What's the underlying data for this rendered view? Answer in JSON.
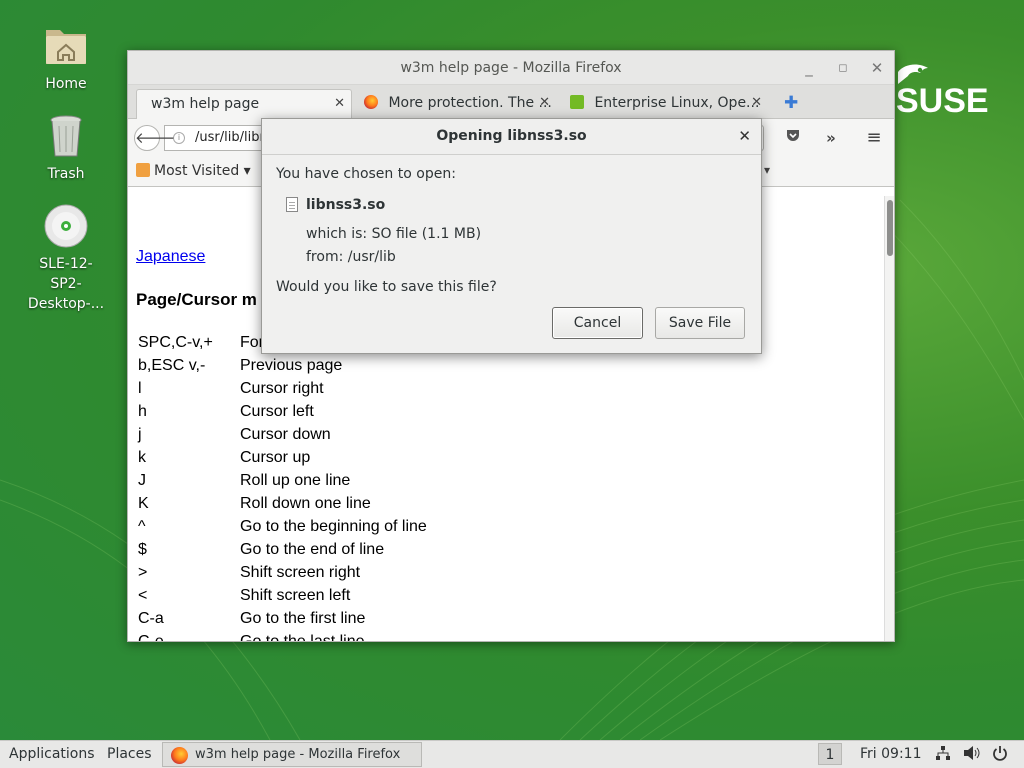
{
  "desktop": {
    "icons": [
      {
        "label": "Home"
      },
      {
        "label": "Trash"
      },
      {
        "label": "SLE-12-\nSP2-\nDesktop-..."
      }
    ],
    "brand_logo_text": "SUSE"
  },
  "firefox": {
    "title": "w3m help page - Mozilla Firefox",
    "tabs": [
      {
        "label": "w3m help page"
      },
      {
        "label": "More protection. The ..."
      },
      {
        "label": "Enterprise Linux, Ope..."
      }
    ],
    "url": "/usr/lib/libn",
    "bookmarks": {
      "most_visited": "Most Visited"
    },
    "page": {
      "link_japanese": "Japanese",
      "heading": "Page/Cursor m",
      "rows": [
        {
          "key": "SPC,C-v,+",
          "desc": "For"
        },
        {
          "key": "b,ESC v,-",
          "desc": "Previous page"
        },
        {
          "key": "l",
          "desc": "Cursor right"
        },
        {
          "key": "h",
          "desc": "Cursor left"
        },
        {
          "key": "j",
          "desc": "Cursor down"
        },
        {
          "key": "k",
          "desc": "Cursor up"
        },
        {
          "key": "J",
          "desc": "Roll up one line"
        },
        {
          "key": "K",
          "desc": "Roll down one line"
        },
        {
          "key": "^",
          "desc": "Go to the beginning of line"
        },
        {
          "key": "$",
          "desc": "Go to the end of line"
        },
        {
          "key": ">",
          "desc": "Shift screen right"
        },
        {
          "key": "<",
          "desc": "Shift screen left"
        },
        {
          "key": "C-a",
          "desc": "Go to the first line"
        },
        {
          "key": "C-e",
          "desc": "Go to the last line"
        }
      ]
    }
  },
  "dialog": {
    "title": "Opening libnss3.so",
    "chosen_text": "You have chosen to open:",
    "filename": "libnss3.so",
    "which_is": "which is: SO file (1.1 MB)",
    "from": "from: /usr/lib",
    "question": "Would you like to save this file?",
    "cancel_label": "Cancel",
    "save_label": "Save File"
  },
  "taskbar": {
    "applications": "Applications",
    "places": "Places",
    "window_label": "w3m help page - Mozilla Firefox",
    "workspace": "1",
    "clock": "Fri 09:11"
  },
  "colors": {
    "desktop_green": "#3b8f2b",
    "link_blue": "#0000ee"
  }
}
